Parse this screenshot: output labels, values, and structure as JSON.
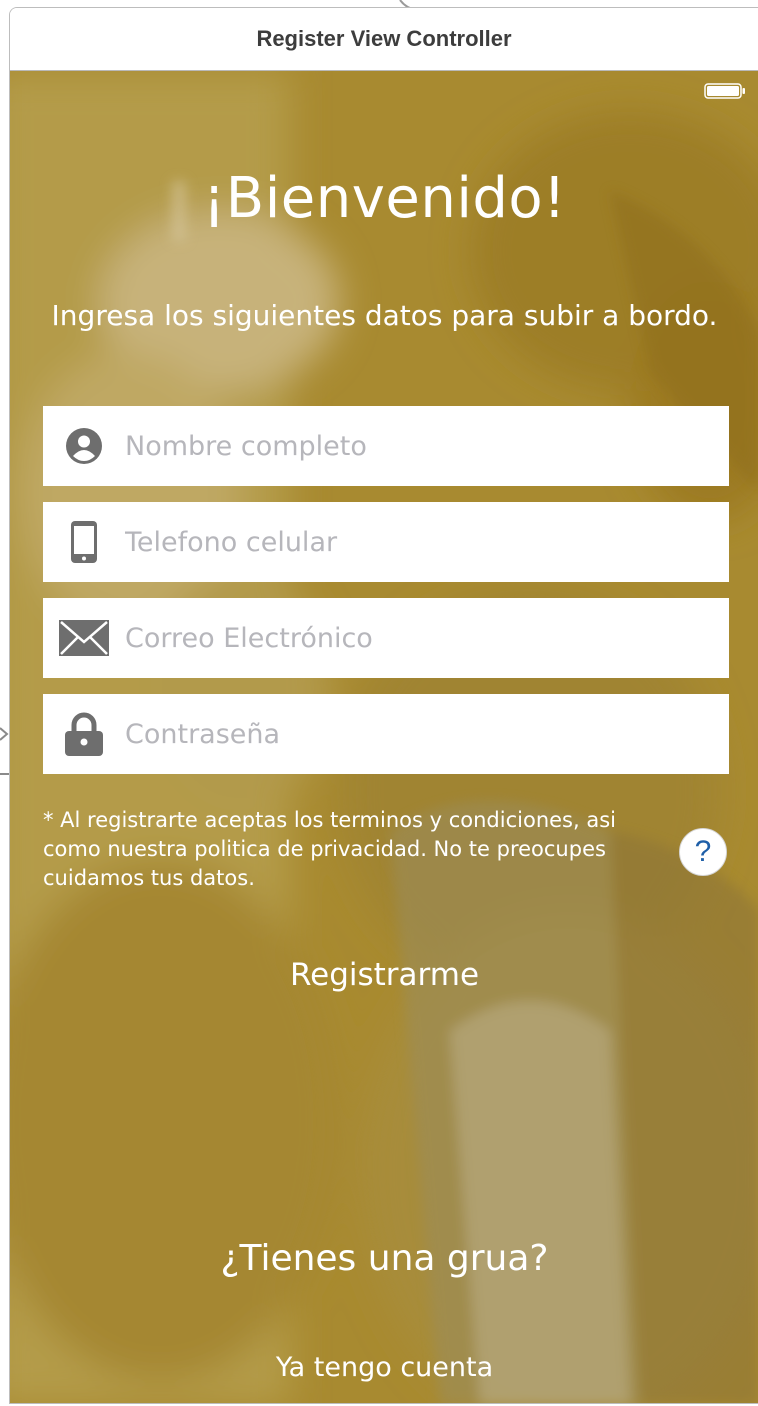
{
  "scene": {
    "title": "Register View Controller"
  },
  "screen": {
    "welcome_title": "¡Bienvenido!",
    "subtitle": "Ingresa los siguientes datos para subir a bordo.",
    "fields": [
      {
        "icon": "user-icon",
        "placeholder": "Nombre completo",
        "value": ""
      },
      {
        "icon": "phone-icon",
        "placeholder": "Telefono celular",
        "value": ""
      },
      {
        "icon": "envelope-icon",
        "placeholder": "Correo Electrónico",
        "value": ""
      },
      {
        "icon": "lock-icon",
        "placeholder": "Contraseña",
        "value": ""
      }
    ],
    "terms_text": "* Al registrarte aceptas los terminos y condiciones, asi como nuestra politica de privacidad. No te preocupes cuidamos tus datos.",
    "help_label": "?",
    "register_label": "Registrarme",
    "crane_label": "¿Tienes una grua?",
    "login_label": "Ya tengo cuenta"
  },
  "colors": {
    "overlay_gold": "#a4862b",
    "text_white": "#ffffff",
    "placeholder_gray": "#b6b6bb",
    "icon_gray": "#6e6e6e",
    "help_blue": "#1f5fa8"
  }
}
